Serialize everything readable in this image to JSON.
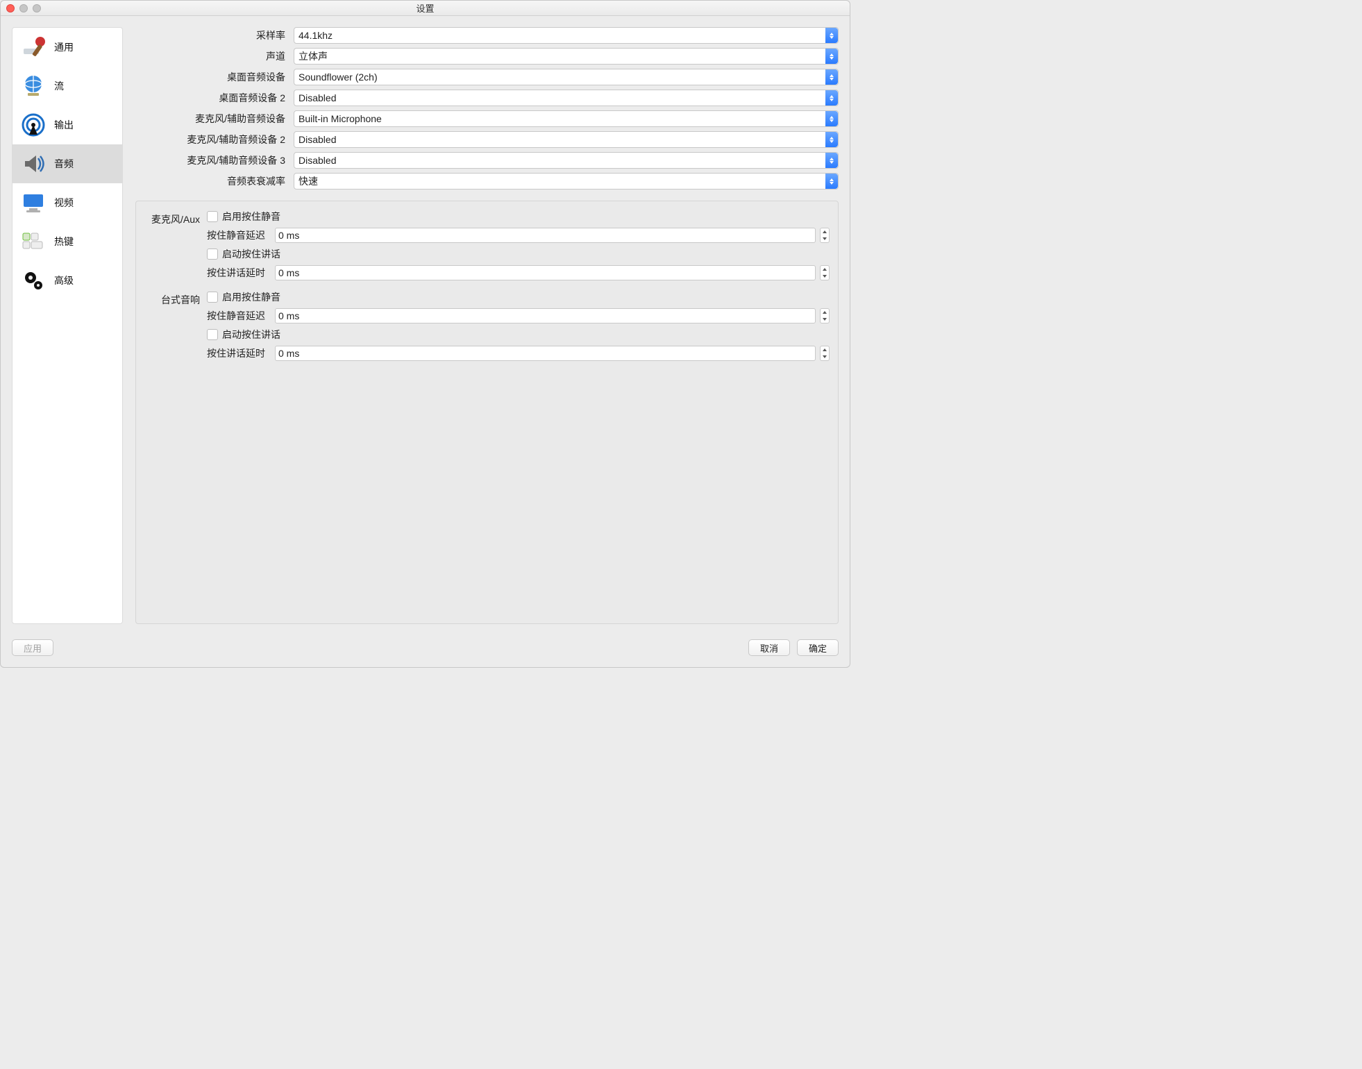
{
  "window": {
    "title": "设置"
  },
  "sidebar": {
    "items": [
      {
        "label": "通用"
      },
      {
        "label": "流"
      },
      {
        "label": "输出"
      },
      {
        "label": "音频"
      },
      {
        "label": "视频"
      },
      {
        "label": "热键"
      },
      {
        "label": "高级"
      }
    ],
    "active_index": 3
  },
  "form": {
    "sample_rate": {
      "label": "采样率",
      "value": "44.1khz"
    },
    "channels": {
      "label": "声道",
      "value": "立体声"
    },
    "desktop_audio": {
      "label": "桌面音频设备",
      "value": "Soundflower (2ch)"
    },
    "desktop_audio2": {
      "label": "桌面音频设备 2",
      "value": "Disabled"
    },
    "mic_aux": {
      "label": "麦克风/辅助音频设备",
      "value": "Built-in Microphone"
    },
    "mic_aux2": {
      "label": "麦克风/辅助音频设备 2",
      "value": "Disabled"
    },
    "mic_aux3": {
      "label": "麦克风/辅助音频设备 3",
      "value": "Disabled"
    },
    "decay_rate": {
      "label": "音频表衰减率",
      "value": "快速"
    }
  },
  "hotkey_group": {
    "mic": {
      "title": "麦克风/Aux",
      "enable_ptm": "启用按住静音",
      "ptm_delay_label": "按住静音延迟",
      "ptm_delay_value": "0 ms",
      "enable_ptt": "启动按住讲话",
      "ptt_delay_label": "按住讲话延时",
      "ptt_delay_value": "0 ms"
    },
    "desktop": {
      "title": "台式音响",
      "enable_ptm": "启用按住静音",
      "ptm_delay_label": "按住静音延迟",
      "ptm_delay_value": "0 ms",
      "enable_ptt": "启动按住讲话",
      "ptt_delay_label": "按住讲话延时",
      "ptt_delay_value": "0 ms"
    }
  },
  "footer": {
    "apply": "应用",
    "cancel": "取消",
    "ok": "确定"
  }
}
